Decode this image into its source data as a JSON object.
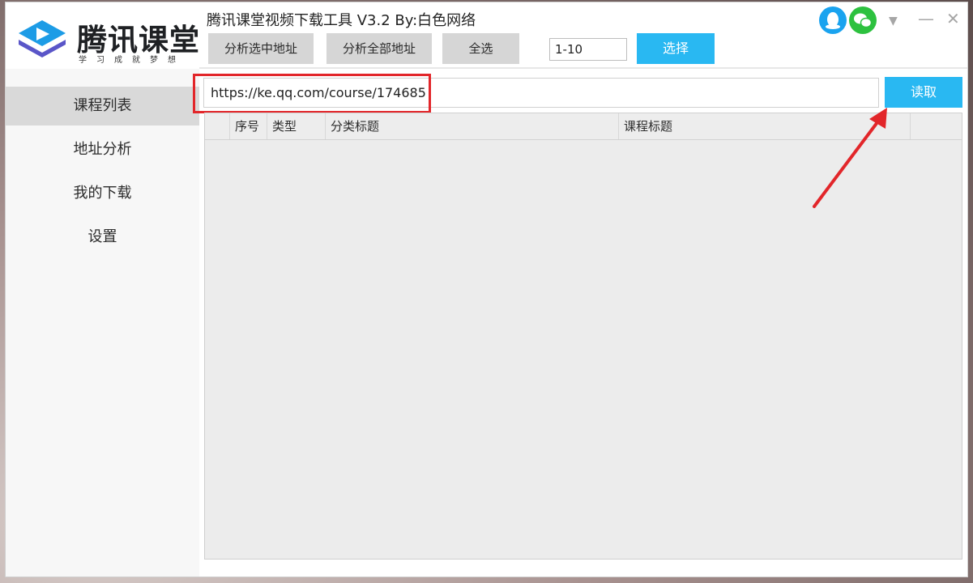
{
  "window": {
    "title": "腾讯课堂视频下载工具 V3.2 By:白色网络"
  },
  "logo": {
    "name": "腾讯课堂",
    "slogan": "学习成就梦想"
  },
  "toolbar": {
    "analyze_selected": "分析选中地址",
    "analyze_all": "分析全部地址",
    "select_all": "全选",
    "range_value": "1-10",
    "select_button": "选择"
  },
  "sidebar": {
    "items": [
      {
        "label": "课程列表",
        "active": true
      },
      {
        "label": "地址分析",
        "active": false
      },
      {
        "label": "我的下载",
        "active": false
      },
      {
        "label": "设置",
        "active": false
      }
    ]
  },
  "url_bar": {
    "value": "https://ke.qq.com/course/174685",
    "read_button": "读取"
  },
  "table": {
    "headers": [
      "序号",
      "类型",
      "分类标题",
      "课程标题"
    ],
    "rows": []
  },
  "titlebar_icons": [
    "qq-icon",
    "wechat-icon",
    "dropdown-icon",
    "minimize-icon",
    "close-icon"
  ],
  "colors": {
    "accent_blue": "#29b8f2",
    "highlight_red": "#e2262a",
    "qq_blue": "#1aa3ef",
    "wechat_green": "#2dc13f"
  }
}
